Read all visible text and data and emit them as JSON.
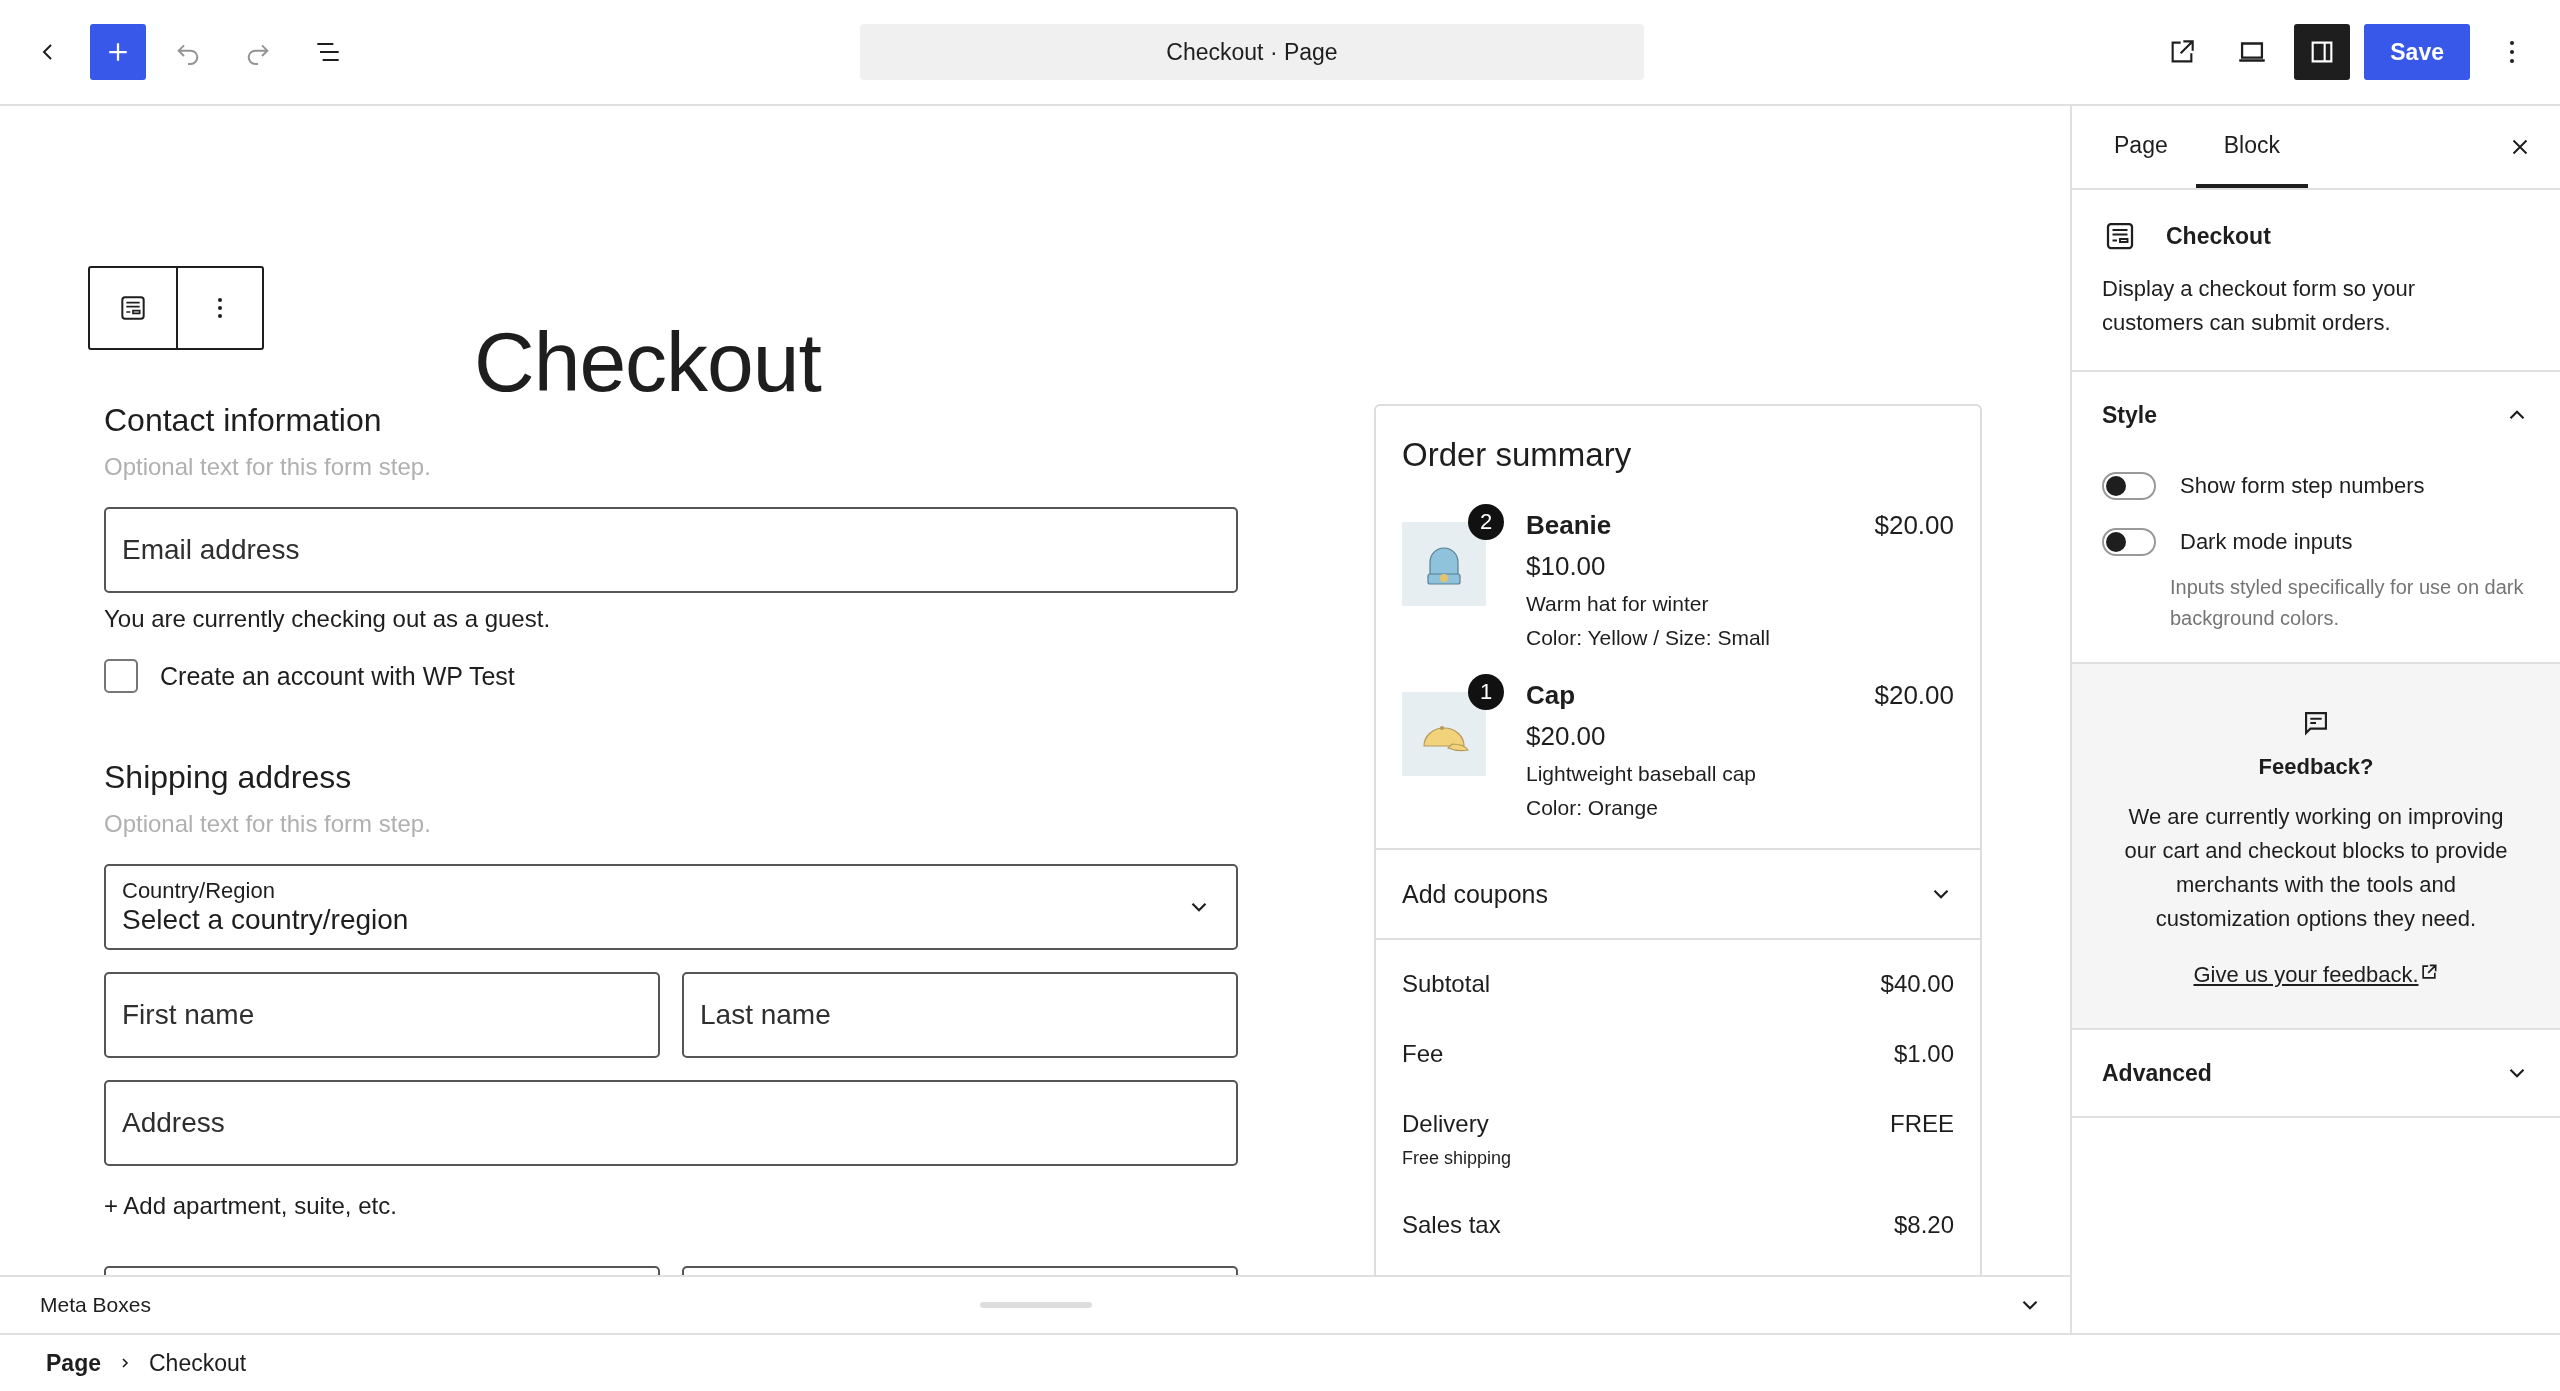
{
  "toolbar": {
    "document_title": "Checkout · Page",
    "save_label": "Save",
    "sidebar_toggle_on": true
  },
  "page_title": "Checkout",
  "contact": {
    "heading": "Contact information",
    "hint": "Optional text for this form step.",
    "email_placeholder": "Email address",
    "guest_note": "You are currently checking out as a guest.",
    "create_account": {
      "label": "Create an account with WP Test",
      "checked": false
    }
  },
  "shipping": {
    "heading": "Shipping address",
    "hint": "Optional text for this form step.",
    "country": {
      "label": "Country/Region",
      "value": "Select a country/region"
    },
    "first_name_placeholder": "First name",
    "last_name_placeholder": "Last name",
    "address_placeholder": "Address",
    "add_apartment": "+ Add apartment, suite, etc."
  },
  "order_summary": {
    "heading": "Order summary",
    "items": [
      {
        "name": "Beanie",
        "quantity": "2",
        "unit_price": "$10.00",
        "total": "$20.00",
        "description": "Warm hat for winter",
        "variation": "Color: Yellow / Size: Small"
      },
      {
        "name": "Cap",
        "quantity": "1",
        "unit_price": "$20.00",
        "total": "$20.00",
        "description": "Lightweight baseball cap",
        "variation": "Color: Orange"
      }
    ],
    "coupons": {
      "label": "Add coupons",
      "expanded": false
    },
    "totals": [
      {
        "label": "Subtotal",
        "value": "$40.00"
      },
      {
        "label": "Fee",
        "value": "$1.00"
      },
      {
        "label": "Delivery",
        "value": "FREE",
        "note": "Free shipping"
      },
      {
        "label": "Sales tax",
        "value": "$8.20"
      }
    ]
  },
  "meta_boxes": {
    "label": "Meta Boxes",
    "expanded": false
  },
  "breadcrumb": [
    "Page",
    "Checkout"
  ],
  "sidebar": {
    "tabs": [
      {
        "label": "Page",
        "selected": false
      },
      {
        "label": "Block",
        "selected": true
      }
    ],
    "block": {
      "name": "Checkout",
      "description": "Display a checkout form so your customers can submit orders."
    },
    "style": {
      "heading": "Style",
      "expanded": true,
      "toggles": [
        {
          "label": "Show form step numbers",
          "on": false
        },
        {
          "label": "Dark mode inputs",
          "on": false,
          "help": "Inputs styled specifically for use on dark background colors."
        }
      ]
    },
    "feedback": {
      "heading": "Feedback?",
      "text": "We are currently working on improving our cart and checkout blocks to provide merchants with the tools and customization options they need.",
      "link": "Give us your feedback."
    },
    "advanced": {
      "heading": "Advanced",
      "expanded": false
    }
  }
}
